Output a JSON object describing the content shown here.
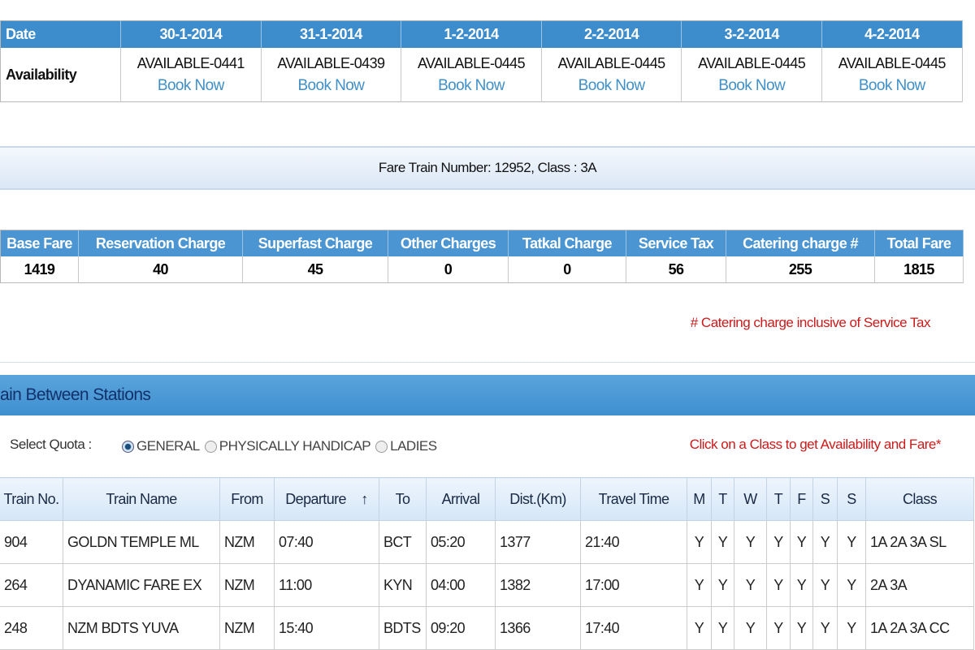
{
  "availability": {
    "date_label": "Date",
    "row_label": "Availability",
    "book_label": "Book Now",
    "dates": [
      {
        "date": "30-1-2014",
        "status": "AVAILABLE-0441"
      },
      {
        "date": "31-1-2014",
        "status": "AVAILABLE-0439"
      },
      {
        "date": "1-2-2014",
        "status": "AVAILABLE-0445"
      },
      {
        "date": "2-2-2014",
        "status": "AVAILABLE-0445"
      },
      {
        "date": "3-2-2014",
        "status": "AVAILABLE-0445"
      },
      {
        "date": "4-2-2014",
        "status": "AVAILABLE-0445"
      }
    ]
  },
  "fare": {
    "title": "Fare Train Number: 12952, Class : 3A",
    "headers": [
      "Base Fare",
      "Reservation Charge",
      "Superfast Charge",
      "Other Charges",
      "Tatkal Charge",
      "Service Tax",
      "Catering charge #",
      "Total Fare"
    ],
    "values": [
      "1419",
      "40",
      "45",
      "0",
      "0",
      "56",
      "255",
      "1815"
    ],
    "note": "# Catering charge inclusive of Service Tax"
  },
  "section_title": "ain Between Stations",
  "quota": {
    "label": "Select Quota :",
    "options": [
      "GENERAL",
      "PHYSICALLY HANDICAP",
      "LADIES"
    ],
    "selected": "GENERAL"
  },
  "hint": "Click on a Class to get Availability and Fare*",
  "trains": {
    "headers": [
      "Train No.",
      "Train Name",
      "From",
      "Departure",
      "To",
      "Arrival",
      "Dist.(Km)",
      "Travel Time",
      "M",
      "T",
      "W",
      "T",
      "F",
      "S",
      "S",
      "Class"
    ],
    "rows": [
      [
        "904",
        "GOLDN TEMPLE ML",
        "NZM",
        "07:40",
        "BCT",
        "05:20",
        "1377",
        "21:40",
        "Y",
        "Y",
        "Y",
        "Y",
        "Y",
        "Y",
        "Y",
        "1A 2A 3A SL"
      ],
      [
        "264",
        "DYANAMIC FARE EX",
        "NZM",
        "11:00",
        "KYN",
        "04:00",
        "1382",
        "17:00",
        "Y",
        "Y",
        "Y",
        "Y",
        "Y",
        "Y",
        "Y",
        "2A 3A"
      ],
      [
        "248",
        "NZM BDTS YUVA",
        "NZM",
        "15:40",
        "BDTS",
        "09:20",
        "1366",
        "17:40",
        "Y",
        "Y",
        "Y",
        "Y",
        "Y",
        "Y",
        "Y",
        "1A 2A 3A CC"
      ]
    ]
  }
}
